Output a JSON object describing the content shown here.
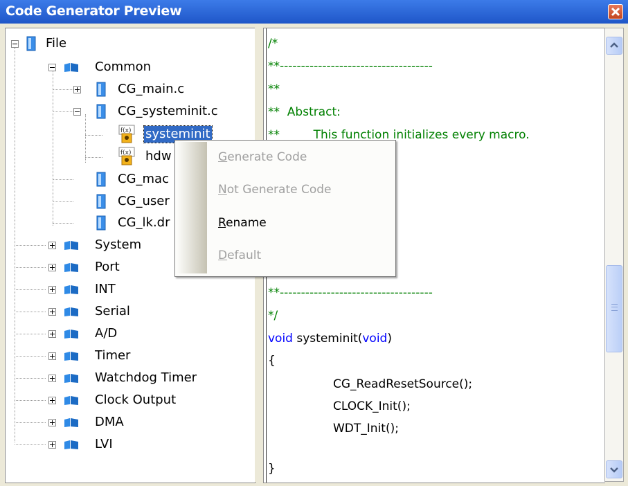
{
  "window": {
    "title": "Code Generator Preview"
  },
  "tree": {
    "root": {
      "label": "File"
    },
    "common": {
      "label": "Common"
    },
    "cg_main": {
      "label": "CG_main.c"
    },
    "cg_systeminit": {
      "label": "CG_systeminit.c"
    },
    "fn_systeminit": {
      "label": "systeminit"
    },
    "fn_hdw": {
      "label": "hdw"
    },
    "cg_mac": {
      "label": "CG_mac"
    },
    "cg_user": {
      "label": "CG_user"
    },
    "cg_lk": {
      "label": "CG_lk.dr"
    },
    "groups": [
      {
        "label": "System"
      },
      {
        "label": "Port"
      },
      {
        "label": "INT"
      },
      {
        "label": "Serial"
      },
      {
        "label": "A/D"
      },
      {
        "label": "Timer"
      },
      {
        "label": "Watchdog Timer"
      },
      {
        "label": "Clock Output"
      },
      {
        "label": "DMA"
      },
      {
        "label": "LVI"
      }
    ]
  },
  "editor": {
    "lines": [
      "/*",
      "**------------------------------------",
      "**",
      "**  Abstract:",
      "**         This function initializes every macro.",
      "**",
      "**------------------------------------",
      "*/",
      "void",
      " systeminit(",
      "void",
      ")",
      "{",
      "CG_ReadResetSource();",
      "CLOCK_Init();",
      "WDT_Init();",
      "}"
    ]
  },
  "context_menu": {
    "items": [
      {
        "accel": "G",
        "rest": "enerate Code",
        "enabled": false
      },
      {
        "accel": "N",
        "rest": "ot Generate Code",
        "enabled": false
      },
      {
        "accel": "R",
        "rest": "ename",
        "enabled": true
      },
      {
        "accel": "D",
        "rest": "efault",
        "enabled": false
      }
    ]
  },
  "colors": {
    "titlebar": "#1f56c8",
    "comment": "#008000",
    "keyword": "#0000ff",
    "selection": "#316ac5",
    "disabled_text": "#a0a0a0"
  },
  "icons": [
    "close-icon",
    "expand-icon",
    "collapse-icon",
    "folder-icon",
    "file-icon",
    "function-icon",
    "scroll-up-icon",
    "scroll-down-icon"
  ]
}
